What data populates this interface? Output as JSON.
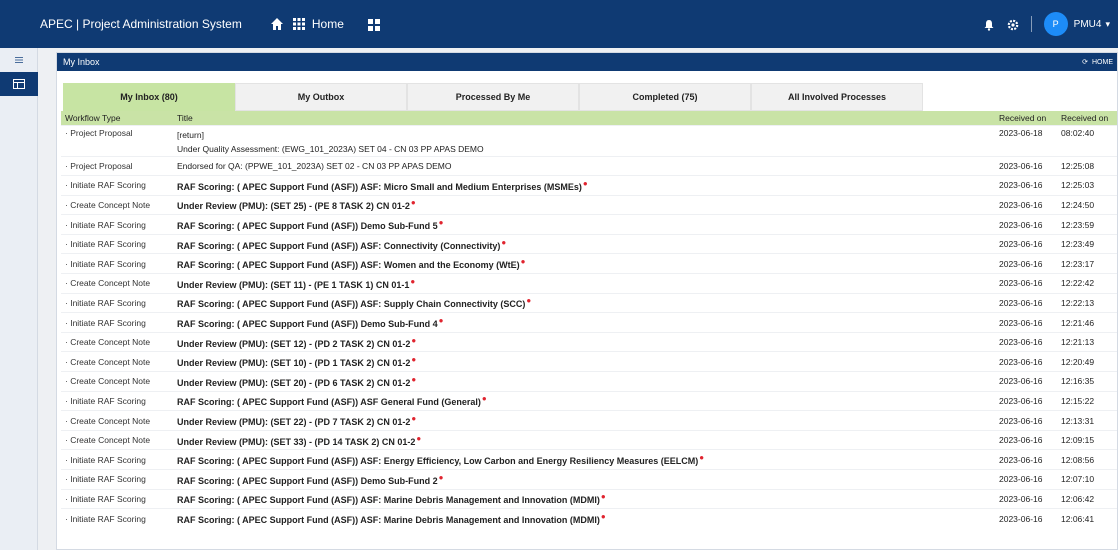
{
  "app": {
    "brand": "APEC | Project Administration System",
    "home_label": "Home",
    "user_initial": "P",
    "user_name": "PMU4"
  },
  "panel": {
    "title": "My Inbox",
    "home_tag": "HOME"
  },
  "tabs": [
    {
      "label": "My Inbox (80)",
      "active": true
    },
    {
      "label": "My Outbox",
      "active": false
    },
    {
      "label": "Processed By Me",
      "active": false
    },
    {
      "label": "Completed (75)",
      "active": false
    },
    {
      "label": "All Involved Processes",
      "active": false
    }
  ],
  "columns": {
    "type": "Workflow Type",
    "title": "Title",
    "date": "Received on",
    "time": "Received on"
  },
  "rows": [
    {
      "type": "Project Proposal",
      "title": "[return]",
      "title2": "Under Quality Assessment: (EWG_101_2023A) SET 04 - CN 03 PP APAS DEMO",
      "bold": false,
      "dot": false,
      "date": "2023-06-18",
      "time": "08:02:40"
    },
    {
      "type": "Project Proposal",
      "title": "Endorsed for QA: (PPWE_101_2023A) SET 02 - CN 03 PP APAS DEMO",
      "bold": false,
      "dot": false,
      "date": "2023-06-16",
      "time": "12:25:08"
    },
    {
      "type": "Initiate RAF Scoring",
      "title": "RAF Scoring: ( APEC Support Fund (ASF)) ASF: Micro Small and Medium Enterprises (MSMEs)",
      "bold": true,
      "dot": true,
      "date": "2023-06-16",
      "time": "12:25:03"
    },
    {
      "type": "Create Concept Note",
      "title": "Under Review (PMU): (SET 25) - (PE 8 TASK 2) CN 01-2",
      "bold": true,
      "dot": true,
      "date": "2023-06-16",
      "time": "12:24:50"
    },
    {
      "type": "Initiate RAF Scoring",
      "title": "RAF Scoring: ( APEC Support Fund (ASF)) Demo Sub-Fund 5",
      "bold": true,
      "dot": true,
      "date": "2023-06-16",
      "time": "12:23:59"
    },
    {
      "type": "Initiate RAF Scoring",
      "title": "RAF Scoring: ( APEC Support Fund (ASF)) ASF: Connectivity (Connectivity)",
      "bold": true,
      "dot": true,
      "date": "2023-06-16",
      "time": "12:23:49"
    },
    {
      "type": "Initiate RAF Scoring",
      "title": "RAF Scoring: ( APEC Support Fund (ASF)) ASF: Women and the Economy (WtE)",
      "bold": true,
      "dot": true,
      "date": "2023-06-16",
      "time": "12:23:17"
    },
    {
      "type": "Create Concept Note",
      "title": "Under Review (PMU): (SET 11) - (PE 1 TASK 1) CN 01-1",
      "bold": true,
      "dot": true,
      "date": "2023-06-16",
      "time": "12:22:42"
    },
    {
      "type": "Initiate RAF Scoring",
      "title": "RAF Scoring: ( APEC Support Fund (ASF)) ASF: Supply Chain Connectivity (SCC)",
      "bold": true,
      "dot": true,
      "date": "2023-06-16",
      "time": "12:22:13"
    },
    {
      "type": "Initiate RAF Scoring",
      "title": "RAF Scoring: ( APEC Support Fund (ASF)) Demo Sub-Fund 4",
      "bold": true,
      "dot": true,
      "date": "2023-06-16",
      "time": "12:21:46"
    },
    {
      "type": "Create Concept Note",
      "title": "Under Review (PMU): (SET 12) - (PD 2 TASK 2) CN 01-2",
      "bold": true,
      "dot": true,
      "date": "2023-06-16",
      "time": "12:21:13"
    },
    {
      "type": "Create Concept Note",
      "title": "Under Review (PMU): (SET 10) - (PD 1 TASK 2) CN 01-2",
      "bold": true,
      "dot": true,
      "date": "2023-06-16",
      "time": "12:20:49"
    },
    {
      "type": "Create Concept Note",
      "title": "Under Review (PMU): (SET 20) - (PD 6 TASK 2) CN 01-2",
      "bold": true,
      "dot": true,
      "date": "2023-06-16",
      "time": "12:16:35"
    },
    {
      "type": "Initiate RAF Scoring",
      "title": "RAF Scoring: ( APEC Support Fund (ASF)) ASF General Fund (General)",
      "bold": true,
      "dot": true,
      "date": "2023-06-16",
      "time": "12:15:22"
    },
    {
      "type": "Create Concept Note",
      "title": "Under Review (PMU): (SET 22) - (PD 7 TASK 2) CN 01-2",
      "bold": true,
      "dot": true,
      "date": "2023-06-16",
      "time": "12:13:31"
    },
    {
      "type": "Create Concept Note",
      "title": "Under Review (PMU): (SET 33) - (PD 14 TASK 2) CN 01-2",
      "bold": true,
      "dot": true,
      "date": "2023-06-16",
      "time": "12:09:15"
    },
    {
      "type": "Initiate RAF Scoring",
      "title": "RAF Scoring: ( APEC Support Fund (ASF)) ASF: Energy Efficiency, Low Carbon and Energy Resiliency Measures (EELCM)",
      "bold": true,
      "dot": true,
      "date": "2023-06-16",
      "time": "12:08:56"
    },
    {
      "type": "Initiate RAF Scoring",
      "title": "RAF Scoring: ( APEC Support Fund (ASF)) Demo Sub-Fund 2",
      "bold": true,
      "dot": true,
      "date": "2023-06-16",
      "time": "12:07:10"
    },
    {
      "type": "Initiate RAF Scoring",
      "title": "RAF Scoring: ( APEC Support Fund (ASF)) ASF: Marine Debris Management and Innovation (MDMI)",
      "bold": true,
      "dot": true,
      "date": "2023-06-16",
      "time": "12:06:42"
    },
    {
      "type": "Initiate RAF Scoring",
      "title": "RAF Scoring: ( APEC Support Fund (ASF)) ASF: Marine Debris Management and Innovation (MDMI)",
      "bold": true,
      "dot": true,
      "date": "2023-06-16",
      "time": "12:06:41"
    }
  ],
  "icons": {
    "home": "home-icon",
    "grid": "grid-icon",
    "bell": "bell-icon",
    "gear": "gear-icon",
    "menu": "menu-icon",
    "inbox": "inbox-icon"
  },
  "colors": {
    "header": "#0f3a73",
    "tab_active": "#c7e4a3",
    "unread_dot": "#e0242f"
  }
}
